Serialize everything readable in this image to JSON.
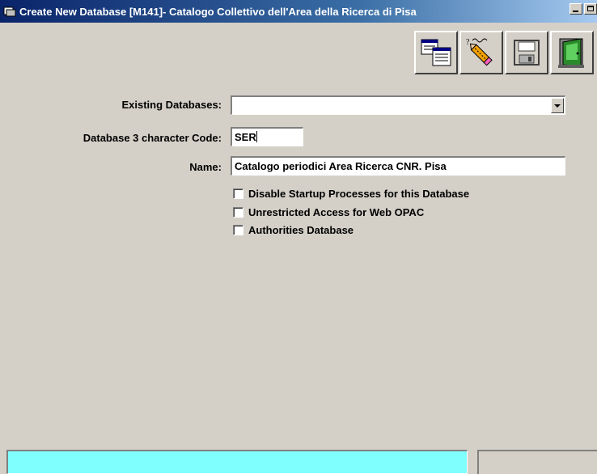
{
  "window": {
    "title": "Create New Database  [M141]- Catalogo Collettivo dell'Area della Ricerca di Pisa"
  },
  "toolbar": {
    "buttons": [
      {
        "icon": "database-list-icon"
      },
      {
        "icon": "erase-pencil-icon"
      },
      {
        "icon": "save-floppy-icon"
      },
      {
        "icon": "exit-door-icon"
      }
    ]
  },
  "form": {
    "existing_label": "Existing Databases:",
    "existing_value": "",
    "code_label": "Database 3 character Code:",
    "code_value": "SER",
    "name_label": "Name:",
    "name_value": "Catalogo periodici Area Ricerca CNR. Pisa",
    "checkboxes": [
      {
        "label": "Disable Startup Processes for this Database",
        "checked": false
      },
      {
        "label": "Unrestricted Access for Web OPAC",
        "checked": false
      },
      {
        "label": "Authorities Database",
        "checked": false
      }
    ]
  },
  "status": {
    "message": ""
  },
  "colors": {
    "window_bg": "#d4d0c8",
    "title_start": "#0a246a",
    "title_end": "#a6caf0",
    "status_bg": "#80ffff"
  }
}
